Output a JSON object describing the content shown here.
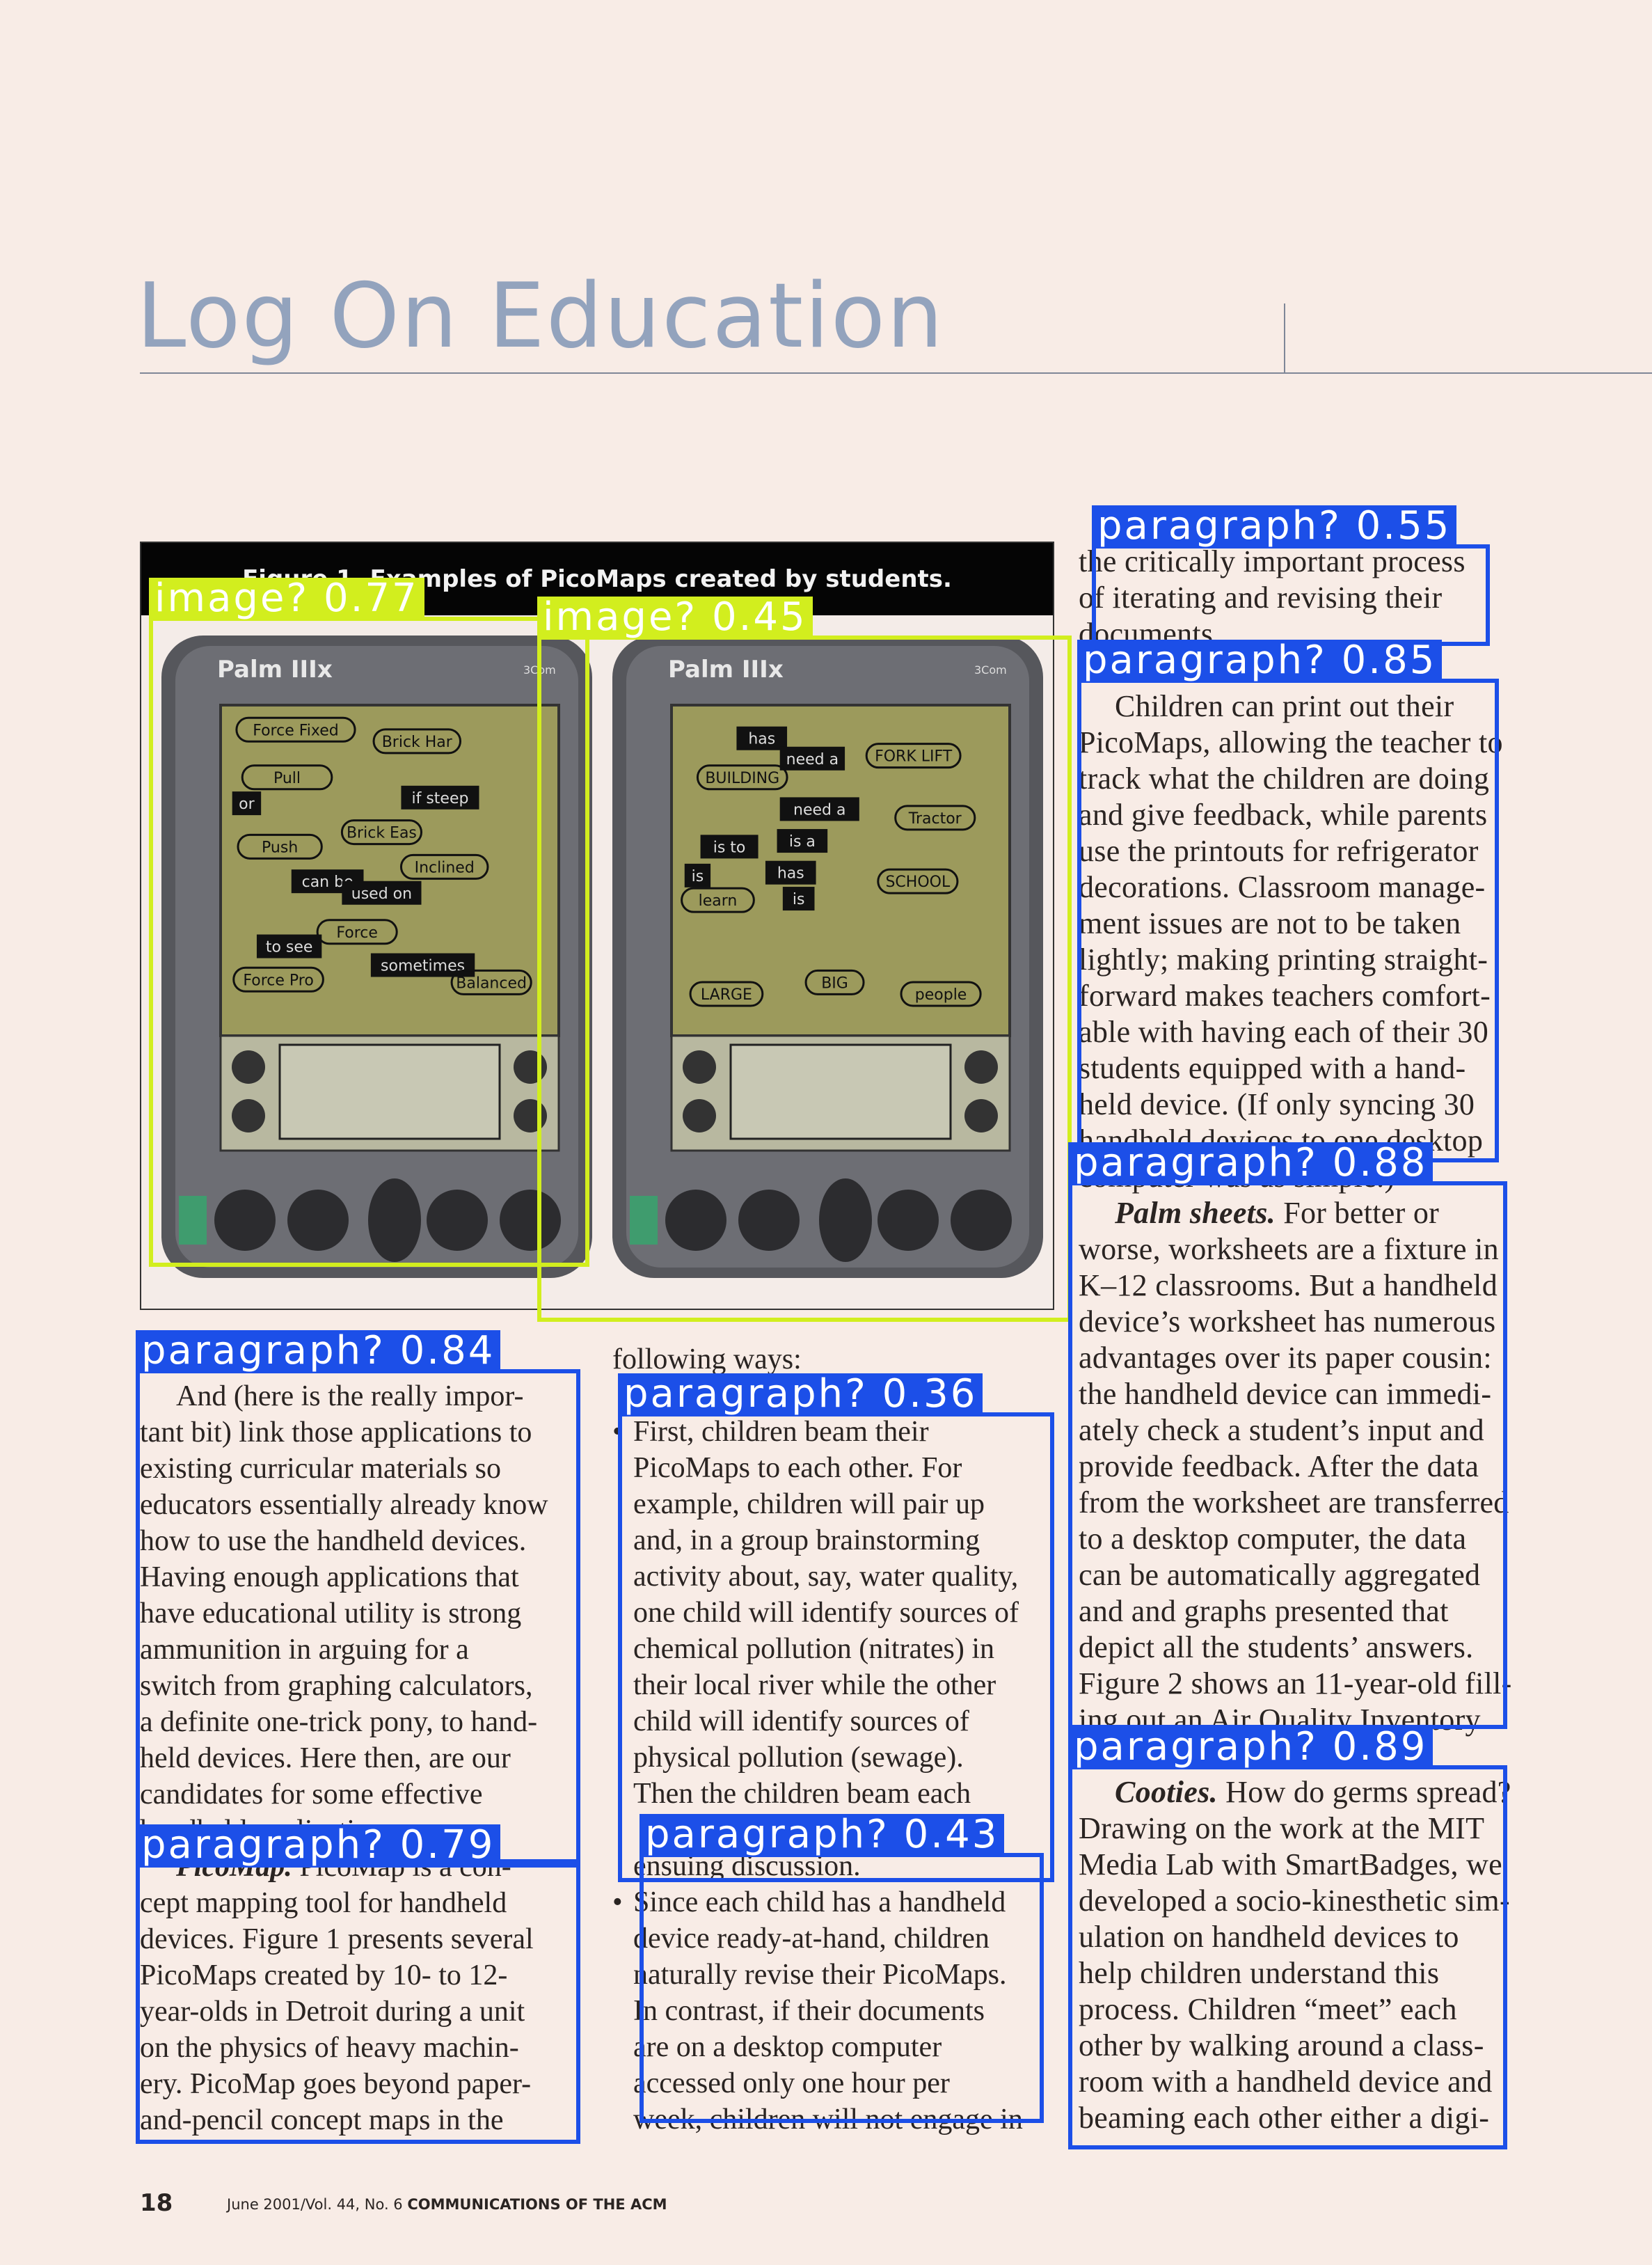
{
  "header": {
    "title": "Log On Education"
  },
  "figure": {
    "caption": "Figure 1. Examples of PicoMaps created by students.",
    "devices": [
      {
        "brand": "Palm IIIx",
        "maker": "3Com",
        "nodes": [
          "Force Fixed",
          "Brick Har",
          "Pull",
          "or",
          "if steep",
          "Brick Eas",
          "Push",
          "Inclined",
          "can be",
          "used on",
          "Force",
          "to see",
          "sometimes",
          "Force Pro",
          "Balanced"
        ]
      },
      {
        "brand": "Palm IIIx",
        "maker": "3Com",
        "nodes": [
          "has",
          "need a",
          "FORK LIFT",
          "BUILDING",
          "need a",
          "Tractor",
          "is to",
          "is a",
          "is",
          "has",
          "SCHOOL",
          "is",
          "learn",
          "LARGE",
          "BIG",
          "people"
        ]
      }
    ]
  },
  "columns": {
    "left": [
      "And (here is the really impor-",
      "tant bit) link those applications to",
      "existing curricular materials so",
      "educators essentially already know",
      "how to use the handheld devices.",
      "Having enough applications that",
      "have educational utility is strong",
      "ammunition in arguing for a",
      "switch from graphing calculators,",
      "a definite one-trick pony, to hand-",
      "held devices. Here then, are our",
      "candidates for some effective",
      "handheld applications:",
      "PicoMap. PicoMap is a con-",
      "cept mapping tool for handheld",
      "devices. Figure 1 presents several",
      "PicoMaps created by 10- to 12-",
      "year-olds in Detroit during a unit",
      "on the physics of heavy machin-",
      "ery. PicoMap goes beyond paper-",
      "and-pencil concept maps in the"
    ],
    "middle": [
      "following ways:",
      "",
      "First, children beam their",
      "PicoMaps to each other. For",
      "example, children will pair up",
      "and, in a group brainstorming",
      "activity about, say, water quality,",
      "one child will identify sources of",
      "chemical pollution (nitrates) in",
      "their local river while the other",
      "child will identify sources of",
      "physical pollution (sewage).",
      "Then the children beam each",
      "",
      "ensuing discussion.",
      "Since each child has a handheld",
      "device ready-at-hand, children",
      "naturally revise their PicoMaps.",
      "In contrast, if their documents",
      "are on a desktop computer",
      "accessed only one hour per",
      "week, children will not engage in"
    ],
    "bullet": "•",
    "right": [
      "the critically important process",
      "of iterating and revising their",
      "documents.",
      "",
      "Children can print out their",
      "PicoMaps, allowing the teacher to",
      "track what the children are doing",
      "and give feedback, while parents",
      "use the printouts for refrigerator",
      "decorations. Classroom manage-",
      "ment issues are not to be taken",
      "lightly; making printing straight-",
      "forward makes teachers comfort-",
      "able with having each of their 30",
      "students equipped with a hand-",
      "held device. (If only syncing 30",
      "handheld devices to one desktop",
      "computer was as simple.)",
      "Palm sheets. For better or",
      "worse, worksheets are a fixture in",
      "K–12 classrooms. But a handheld",
      "device’s worksheet has numerous",
      "advantages over its paper cousin:",
      "the handheld device can immedi-",
      "ately check a student’s input and",
      "provide feedback. After the data",
      "from the worksheet are transferred",
      "to a desktop computer, the data",
      "can be automatically aggregated",
      "and and graphs presented that",
      "depict all the students’ answers.",
      "Figure 2 shows an 11-year-old fill-",
      "ing out an Air Quality Inventory",
      "",
      "Cooties. How do germs spread?",
      "Drawing on the work at the MIT",
      "Media Lab with SmartBadges, we",
      "developed a socio-kinesthetic sim-",
      "ulation on handheld devices to",
      "help children understand this",
      "process. Children “meet” each",
      "other by walking around a class-",
      "room with a handheld device and",
      "beaming each other either a digi-"
    ]
  },
  "footer": {
    "page": "18",
    "issue": "June 2001/Vol. 44, No. 6",
    "magazine": "COMMUNICATIONS OF THE ACM"
  },
  "annotations": [
    {
      "label": "image?",
      "score": "0.77",
      "kind": "image"
    },
    {
      "label": "image?",
      "score": "0.45",
      "kind": "image"
    },
    {
      "label": "paragraph?",
      "score": "0.55",
      "kind": "paragraph"
    },
    {
      "label": "paragraph?",
      "score": "0.85",
      "kind": "paragraph"
    },
    {
      "label": "paragraph?",
      "score": "0.88",
      "kind": "paragraph"
    },
    {
      "label": "paragraph?",
      "score": "0.89",
      "kind": "paragraph"
    },
    {
      "label": "paragraph?",
      "score": "0.84",
      "kind": "paragraph"
    },
    {
      "label": "paragraph?",
      "score": "0.79",
      "kind": "paragraph"
    },
    {
      "label": "paragraph?",
      "score": "0.36",
      "kind": "paragraph"
    },
    {
      "label": "paragraph?",
      "score": "0.43",
      "kind": "paragraph"
    }
  ],
  "colors": {
    "paragraph_box": "#1c4fe8",
    "image_box": "#d2ee1e",
    "title": "#93a3bd",
    "page": "#f8ece6"
  }
}
